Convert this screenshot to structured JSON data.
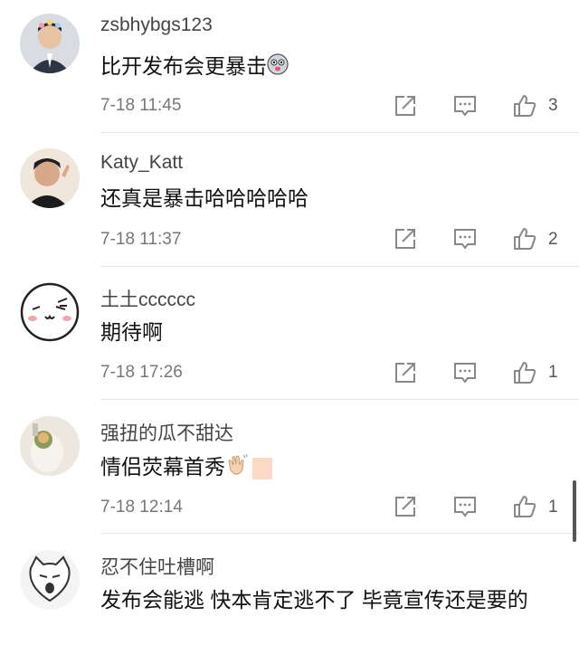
{
  "comments": [
    {
      "user": "zsbhybgs123",
      "text": "比开发布会更暴击",
      "time": "7-18 11:45",
      "likes": "3"
    },
    {
      "user": "Katy_Katt",
      "text": "还真是暴击哈哈哈哈哈",
      "time": "7-18 11:37",
      "likes": "2"
    },
    {
      "user": "土土cccccc",
      "text": "期待啊",
      "time": "7-18 17:26",
      "likes": "1"
    },
    {
      "user": "强扭的瓜不甜达",
      "text": "情侣荧幕首秀",
      "time": "7-18 12:14",
      "likes": "1"
    },
    {
      "user": "忍不住吐槽啊",
      "text": "发布会能逃 快本肯定逃不了 毕竟宣传还是要的",
      "time": "",
      "likes": ""
    }
  ],
  "icons": {
    "share": "share-icon",
    "reply": "reply-icon",
    "like": "thumbs-up-icon"
  },
  "colors": {
    "text": "#111111",
    "meta": "#777777",
    "icon": "#888888",
    "divider": "#e6e6e6"
  }
}
